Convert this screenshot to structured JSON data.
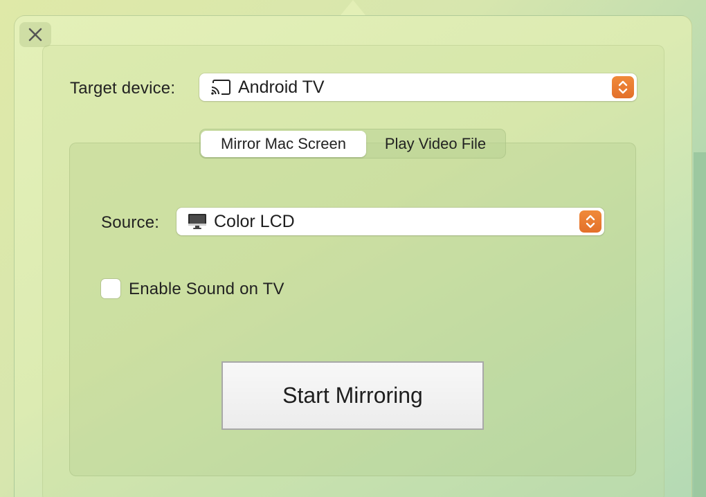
{
  "target_device": {
    "label": "Target device:",
    "selected": "Android TV",
    "icon": "cast-icon"
  },
  "tabs": [
    {
      "label": "Mirror Mac Screen",
      "active": true
    },
    {
      "label": "Play Video File",
      "active": false
    }
  ],
  "source": {
    "label": "Source:",
    "selected": "Color LCD",
    "icon": "display-icon"
  },
  "sound_checkbox": {
    "label": "Enable Sound on TV",
    "checked": false
  },
  "start_button": {
    "label": "Start Mirroring"
  },
  "colors": {
    "accent": "#e97a30"
  }
}
